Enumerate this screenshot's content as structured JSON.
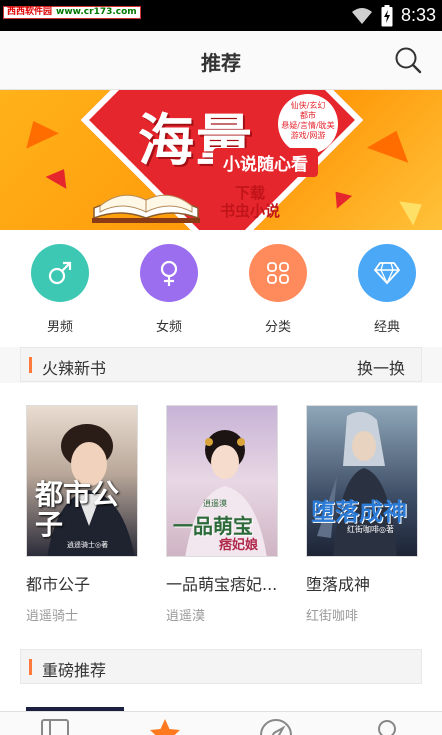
{
  "status_bar": {
    "watermark_site": "西西软件园",
    "watermark_url": "www.cr173.com",
    "time": "8:33"
  },
  "header": {
    "title": "推荐",
    "search_icon": "search-icon"
  },
  "banner": {
    "headline": "海量",
    "tagline": "小说随心看",
    "cta_line1": "下载",
    "cta_line2": "书虫小说",
    "genres": [
      "仙侠/玄幻",
      "都市",
      "悬疑/言情/耽美",
      "游戏/网游"
    ]
  },
  "categories": [
    {
      "label": "男频",
      "icon": "male-icon",
      "color": "#3dc8b4"
    },
    {
      "label": "女频",
      "icon": "female-icon",
      "color": "#9b6ef0"
    },
    {
      "label": "分类",
      "icon": "grid-icon",
      "color": "#ff8a5c"
    },
    {
      "label": "经典",
      "icon": "diamond-icon",
      "color": "#4aa8f6"
    }
  ],
  "hot_section": {
    "title": "火辣新书",
    "more": "换一换",
    "books": [
      {
        "title": "都市公子",
        "author": "逍遥骑士",
        "cover_text": "都市公子",
        "cover_author": "逍遥骑士◎著"
      },
      {
        "title": "一品萌宝痞妃...",
        "author": "逍遥漠",
        "cover_text": "一品萌宝",
        "cover_sub": "痞妃娘",
        "cover_author": "逍遥漠"
      },
      {
        "title": "堕落成神",
        "author": "红街咖啡",
        "cover_text": "堕落成神",
        "cover_author": "红街咖啡◎著"
      }
    ]
  },
  "featured_section": {
    "title": "重磅推荐"
  },
  "bottom_nav": [
    {
      "icon": "bookshelf-icon"
    },
    {
      "icon": "star-icon",
      "active": true
    },
    {
      "icon": "compass-icon"
    },
    {
      "icon": "user-icon"
    }
  ],
  "colors": {
    "accent": "#ff7a3c",
    "banner_red": "#e6262d",
    "banner_orange": "#ffa51a"
  }
}
